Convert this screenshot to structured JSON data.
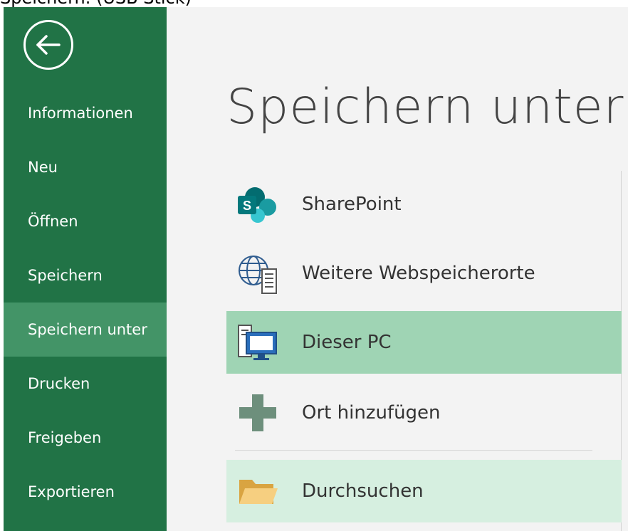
{
  "caption": "Speichern. (USB Stick)",
  "sidebar": {
    "items": [
      {
        "label": "Informationen"
      },
      {
        "label": "Neu"
      },
      {
        "label": "Öffnen"
      },
      {
        "label": "Speichern"
      },
      {
        "label": "Speichern unter"
      },
      {
        "label": "Drucken"
      },
      {
        "label": "Freigeben"
      },
      {
        "label": "Exportieren"
      }
    ],
    "active_item": "Speichern unter",
    "back_icon": "back-arrow-circle-icon",
    "background": "#217346",
    "active_background": "#439467"
  },
  "main": {
    "title": "Speichern unter",
    "locations": [
      {
        "label": "SharePoint",
        "icon": "sharepoint-icon"
      },
      {
        "label": "Weitere Webspeicherorte",
        "icon": "globe-server-icon"
      },
      {
        "label": "Dieser PC",
        "icon": "computer-icon",
        "state": "selected"
      },
      {
        "label": "Ort hinzufügen",
        "icon": "plus-icon"
      },
      {
        "label": "Durchsuchen",
        "icon": "folder-icon",
        "state": "hover"
      }
    ],
    "selected_color": "#9fd4b4",
    "hover_color": "#d6efe0"
  }
}
